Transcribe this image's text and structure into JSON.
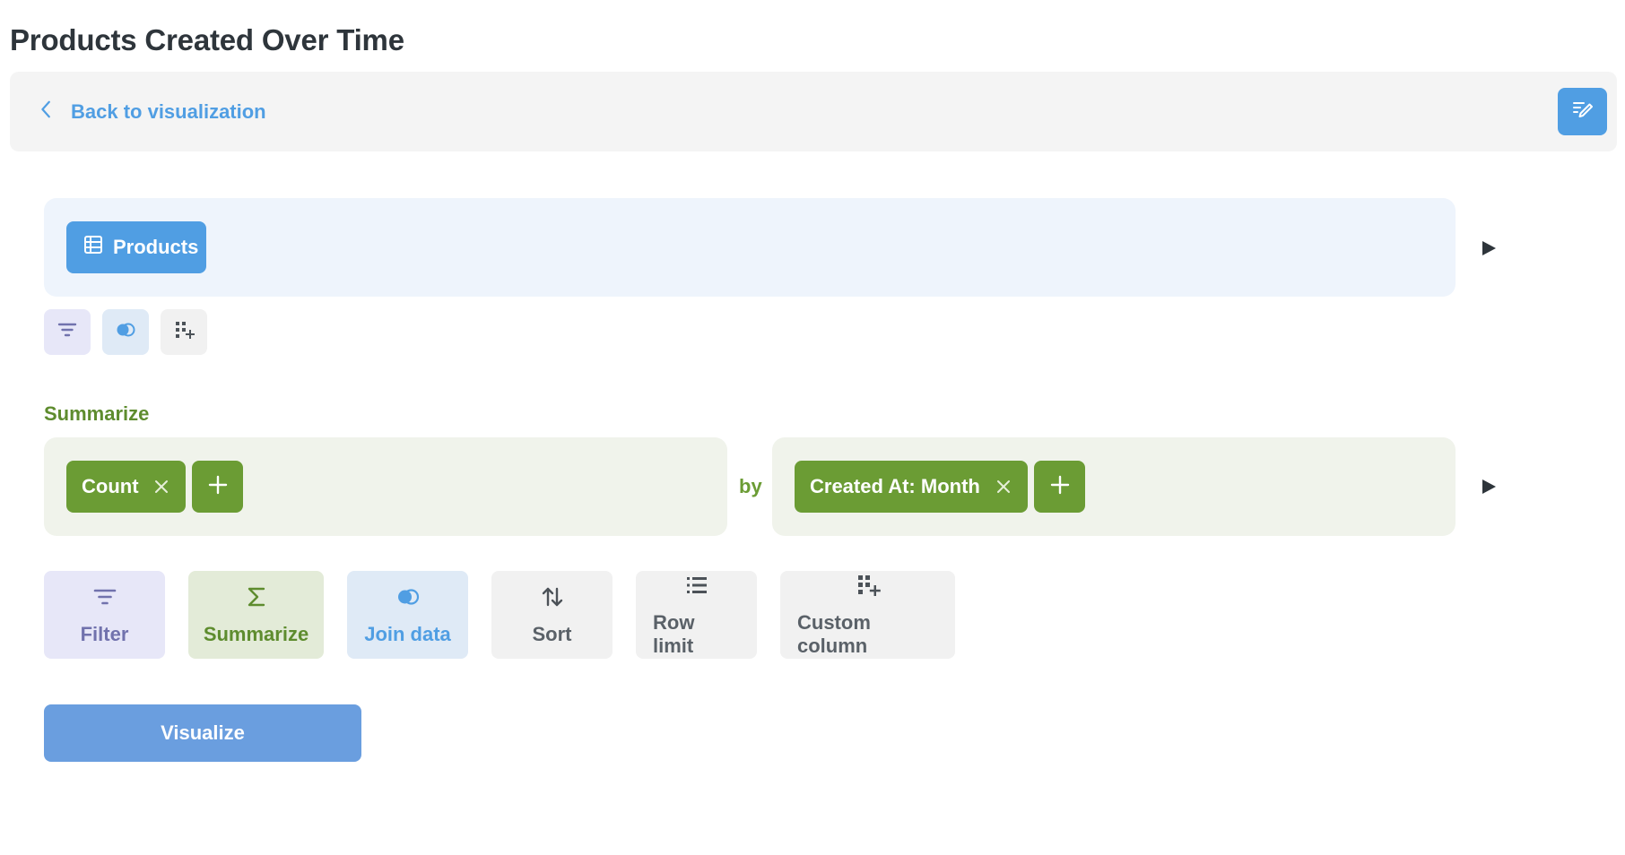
{
  "page": {
    "title": "Products Created Over Time"
  },
  "topbar": {
    "back_label": "Back to visualization",
    "back_icon": "chevron-left-icon",
    "notebook_icon": "notebook-edit-icon"
  },
  "data_step": {
    "source_label": "Products",
    "source_icon": "table-icon",
    "mini_actions": [
      {
        "name": "filter",
        "icon": "filter-icon"
      },
      {
        "name": "join",
        "icon": "join-icon"
      },
      {
        "name": "custom-column",
        "icon": "custom-column-icon"
      }
    ]
  },
  "summarize": {
    "section_label": "Summarize",
    "metric_label": "Count",
    "by_label": "by",
    "breakout_label": "Created At: Month"
  },
  "actions": {
    "filter": "Filter",
    "summarize": "Summarize",
    "join": "Join data",
    "sort": "Sort",
    "row_limit": "Row limit",
    "custom_column": "Custom column"
  },
  "visualize_label": "Visualize",
  "colors": {
    "brand": "#509ee3",
    "summarize_green": "#6b9c34",
    "filter_purple": "#7172ad"
  }
}
